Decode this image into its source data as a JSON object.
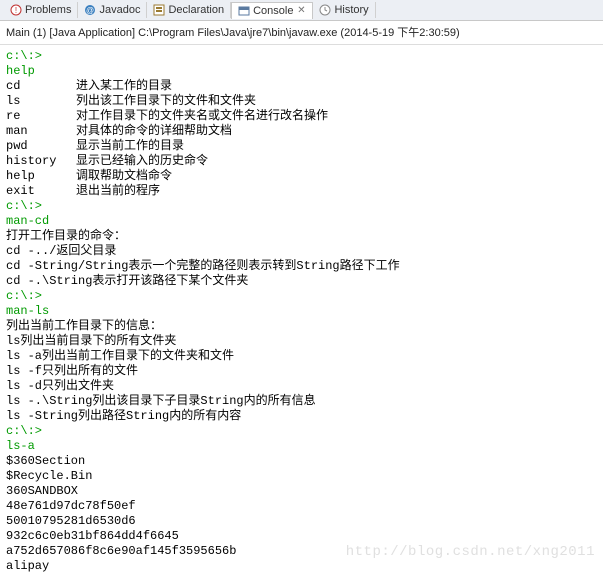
{
  "tabs": {
    "problems": "Problems",
    "javadoc": "Javadoc",
    "declaration": "Declaration",
    "console": "Console",
    "history": "History"
  },
  "context": "Main (1) [Java Application] C:\\Program Files\\Java\\jre7\\bin\\javaw.exe (2014-5-19 下午2:30:59)",
  "console_lines": [
    {
      "prompt": "c:\\:>"
    },
    {
      "cmd_green": "help"
    },
    {
      "cmd": "cd",
      "desc": "进入某工作的目录"
    },
    {
      "cmd": "ls",
      "desc": "列出该工作目录下的文件和文件夹"
    },
    {
      "cmd": "re",
      "desc": "对工作目录下的文件夹名或文件名进行改名操作"
    },
    {
      "cmd": "man",
      "desc": "对具体的命令的详细帮助文档"
    },
    {
      "cmd": "pwd",
      "desc": "显示当前工作的目录"
    },
    {
      "cmd": "history",
      "desc": "显示已经输入的历史命令"
    },
    {
      "cmd": "help",
      "desc": "调取帮助文档命令"
    },
    {
      "cmd": "exit",
      "desc": "退出当前的程序"
    },
    {
      "prompt": "c:\\:>"
    },
    {
      "cmd_green": "man-cd"
    },
    {
      "plain": "打开工作目录的命令："
    },
    {
      "plain": "cd -../返回父目录"
    },
    {
      "plain": "cd -String/String表示一个完整的路径则表示转到String路径下工作"
    },
    {
      "plain": "cd -.\\String表示打开该路径下某个文件夹"
    },
    {
      "prompt": "c:\\:>"
    },
    {
      "cmd_green": "man-ls"
    },
    {
      "plain": "列出当前工作目录下的信息："
    },
    {
      "plain": "ls列出当前目录下的所有文件夹"
    },
    {
      "plain": "ls -a列出当前工作目录下的文件夹和文件"
    },
    {
      "plain": "ls -f只列出所有的文件"
    },
    {
      "plain": "ls -d只列出文件夹"
    },
    {
      "plain": "ls -.\\String列出该目录下子目录String内的所有信息"
    },
    {
      "plain": "ls -String列出路径String内的所有内容"
    },
    {
      "prompt": "c:\\:>"
    },
    {
      "cmd_green": "ls-a"
    },
    {
      "plain": "$360Section"
    },
    {
      "plain": "$Recycle.Bin"
    },
    {
      "plain": "360SANDBOX"
    },
    {
      "plain": "48e761d97dc78f50ef"
    },
    {
      "plain": "50010795281d6530d6"
    },
    {
      "plain": "932c6c0eb31bf864dd4f6645"
    },
    {
      "plain": "a752d657086f8c6e90af145f3595656b"
    },
    {
      "plain": "alipay"
    }
  ],
  "watermark": "http://blog.csdn.net/xng2011"
}
